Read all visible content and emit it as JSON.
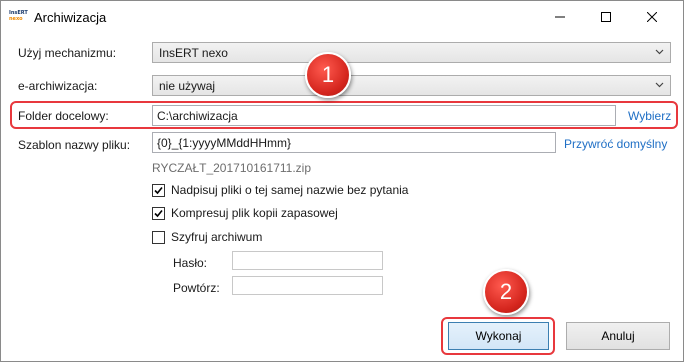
{
  "window": {
    "title": "Archiwizacja",
    "logo_top": "InsERT",
    "logo_bottom": "nexo"
  },
  "form": {
    "mechanism_label": "Użyj mechanizmu:",
    "mechanism_value": "InsERT nexo",
    "earchive_label": "e-archiwizacja:",
    "earchive_value": "nie używaj",
    "folder_label": "Folder docelowy:",
    "folder_value": "C:\\archiwizacja",
    "folder_link": "Wybierz",
    "template_label": "Szablon nazwy pliku:",
    "template_value": "{0}_{1:yyyyMMddHHmm}",
    "template_link": "Przywróć domyślny",
    "filename_preview": "RYCZAŁT_201710161711.zip"
  },
  "options": [
    {
      "label": "Nadpisuj pliki o tej samej nazwie bez pytania",
      "checked": true
    },
    {
      "label": "Kompresuj plik kopii zapasowej",
      "checked": true
    },
    {
      "label": "Szyfruj archiwum",
      "checked": false
    }
  ],
  "password": {
    "password_label": "Hasło:",
    "repeat_label": "Powtórz:"
  },
  "annotations": {
    "badge1": "1",
    "badge2": "2",
    "color": "#e8383d"
  },
  "buttons": {
    "execute": "Wykonaj",
    "cancel": "Anuluj"
  }
}
